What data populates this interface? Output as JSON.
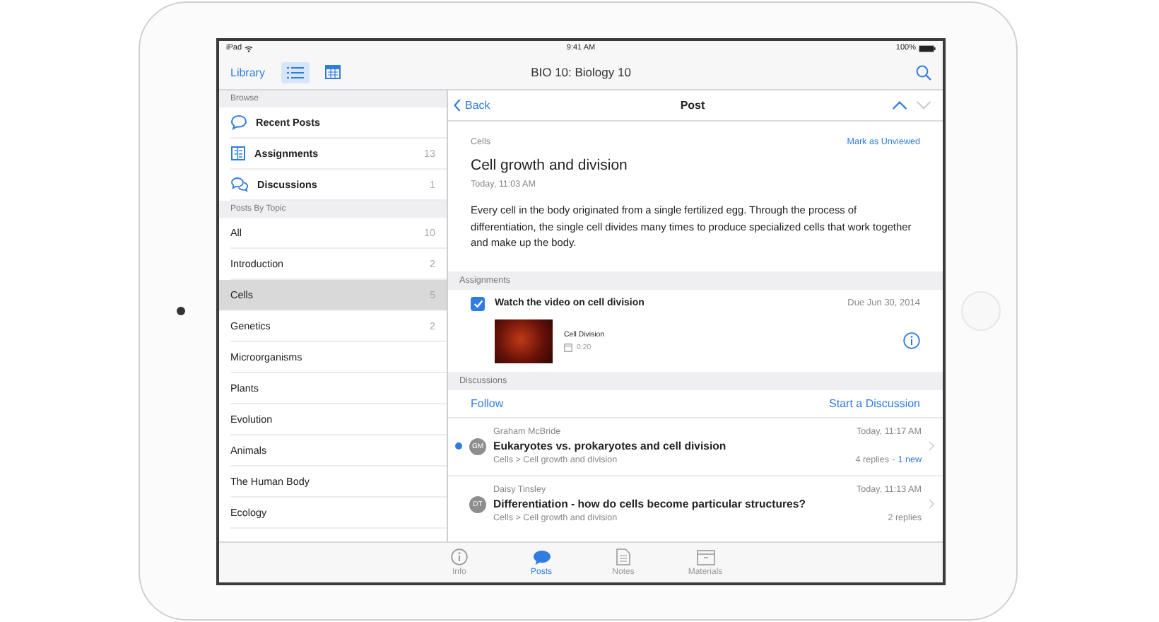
{
  "status_bar": {
    "carrier": "iPad",
    "time": "9:41 AM",
    "battery": "100%"
  },
  "nav_bar": {
    "back": "Library",
    "title": "BIO 10: Biology 10",
    "views": [
      {
        "kind": "list",
        "selected": true
      },
      {
        "kind": "calendar",
        "selected": false
      }
    ]
  },
  "sidebar": {
    "sections": [
      {
        "header": "Browse",
        "items": [
          {
            "kind": "recent",
            "label": "Recent Posts",
            "selected": false
          },
          {
            "kind": "assignments",
            "label": "Assignments",
            "count": "13",
            "selected": false
          },
          {
            "kind": "discussions",
            "label": "Discussions",
            "count": "1",
            "selected": false
          }
        ]
      },
      {
        "header": "Posts By Topic",
        "items": [
          {
            "label": "All",
            "count": "10",
            "selected": false
          },
          {
            "label": "Introduction",
            "count": "2",
            "selected": false
          },
          {
            "label": "Cells",
            "count": "5",
            "selected": true
          },
          {
            "label": "Genetics",
            "count": "2",
            "selected": false
          },
          {
            "label": "Microorganisms",
            "selected": false
          },
          {
            "label": "Plants",
            "selected": false
          },
          {
            "label": "Evolution",
            "selected": false
          },
          {
            "label": "Animals",
            "selected": false
          },
          {
            "label": "The Human Body",
            "selected": false
          },
          {
            "label": "Ecology",
            "selected": false
          }
        ]
      }
    ]
  },
  "post": {
    "back": "Back",
    "title": "Post",
    "topic": "Cells",
    "mark_link": "Mark as Unviewed",
    "heading": "Cell growth and division",
    "time": "Today, 11:03 AM",
    "body": "Every cell in the body originated from a single fertilized egg. Through the process of differentiation, the single cell divides many times to produce specialized cells that work together and make up the body."
  },
  "assignments": {
    "header": "Assignments",
    "items": [
      {
        "title": "Watch the video on cell division",
        "checked": true,
        "due": "Due Jun 30, 2014",
        "attachment": {
          "title": "Cell Division",
          "duration": "0:20"
        }
      }
    ]
  },
  "discussions": {
    "header": "Discussions",
    "follow": "Follow",
    "start": "Start a Discussion",
    "items": [
      {
        "unread": true,
        "initials": "GM",
        "author": "Graham McBride",
        "title": "Eukaryotes vs. prokaryotes and cell division",
        "path": "Cells > Cell growth and division",
        "time": "Today, 11:17 AM",
        "replies": "4 replies",
        "separator": "-",
        "new": "1 new"
      },
      {
        "unread": false,
        "initials": "DT",
        "author": "Daisy Tinsley",
        "title": "Differentiation - how do cells become particular structures?",
        "path": "Cells > Cell growth and division",
        "time": "Today, 11:13 AM",
        "replies": "2 replies"
      }
    ]
  },
  "tab_bar": [
    {
      "kind": "info",
      "label": "Info",
      "selected": false
    },
    {
      "kind": "posts",
      "label": "Posts",
      "selected": true
    },
    {
      "kind": "notes",
      "label": "Notes",
      "selected": false
    },
    {
      "kind": "materials",
      "label": "Materials",
      "selected": false
    }
  ]
}
